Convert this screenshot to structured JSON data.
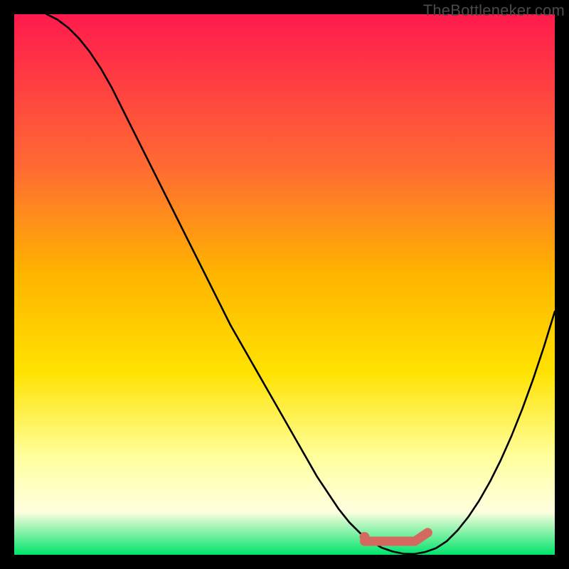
{
  "watermark": "TheBottleneker.com",
  "colors": {
    "gradient_top": "#ff1a4d",
    "gradient_mid1": "#ff6a33",
    "gradient_mid2": "#ffb400",
    "gradient_mid3": "#ffe200",
    "gradient_pale1": "#ffff9e",
    "gradient_pale2": "#ffffe0",
    "gradient_bottom": "#00e36b",
    "curve": "#000000",
    "band": "#d46a5f",
    "frame": "#000000"
  },
  "chart_data": {
    "type": "line",
    "title": "",
    "xlabel": "",
    "ylabel": "",
    "xlim": [
      0,
      100
    ],
    "ylim": [
      0,
      100
    ],
    "grid": false,
    "legend": false,
    "annotations": [],
    "series": [
      {
        "name": "bottleneck-curve",
        "x": [
          6,
          8,
          10,
          12,
          14,
          16,
          18,
          20,
          22,
          24,
          26,
          28,
          30,
          32,
          34,
          36,
          38,
          40,
          42,
          44,
          46,
          48,
          50,
          52,
          54,
          56,
          58,
          60,
          62,
          64,
          66,
          68,
          70,
          72,
          74,
          76,
          78,
          80,
          82,
          84,
          86,
          88,
          90,
          92,
          94,
          96,
          98,
          100
        ],
        "y": [
          100,
          99,
          97.5,
          95.5,
          93,
          90,
          86.5,
          82.5,
          78.5,
          74.5,
          70.5,
          66.5,
          62.5,
          58.5,
          54.5,
          50.5,
          46.5,
          42.5,
          39,
          35.5,
          32,
          28.5,
          25,
          21.5,
          18,
          14.5,
          11.5,
          8.5,
          6,
          4,
          2.5,
          1.3,
          0.6,
          0.2,
          0.15,
          0.5,
          1.2,
          2.5,
          4.5,
          7,
          10,
          13.5,
          17.5,
          22,
          27,
          32.5,
          38.5,
          45
        ]
      }
    ],
    "optimal_band": {
      "x_start": 64.8,
      "x_end": 76.5,
      "y": 2.5,
      "end_bump_y": 4.1
    }
  }
}
